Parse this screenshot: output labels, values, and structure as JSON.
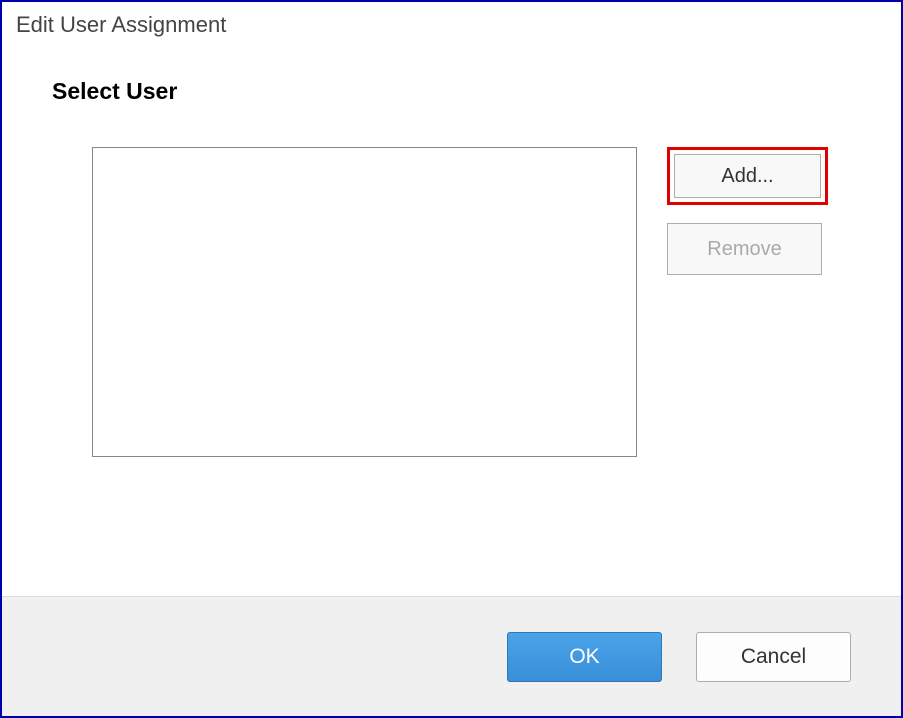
{
  "dialog": {
    "title": "Edit User Assignment",
    "heading": "Select User"
  },
  "buttons": {
    "add": "Add...",
    "remove": "Remove",
    "ok": "OK",
    "cancel": "Cancel"
  }
}
